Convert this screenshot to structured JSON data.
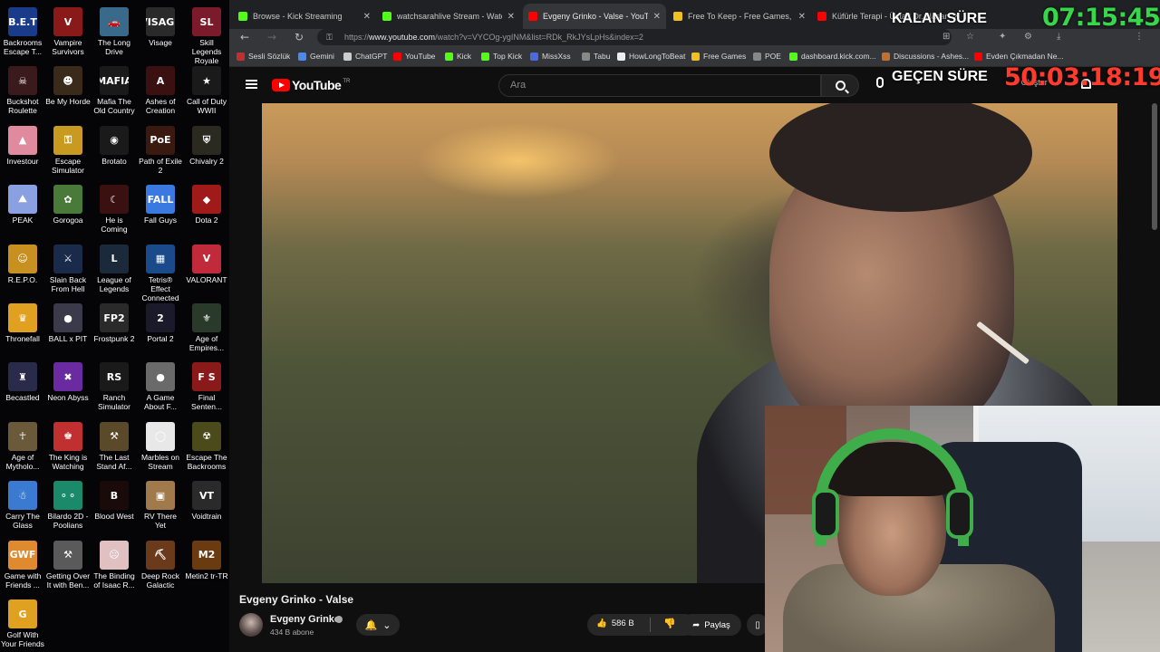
{
  "desktop_icons": [
    {
      "label": "Backrooms Escape T...",
      "glyph": "B.E.T",
      "color": "#1a3a8a"
    },
    {
      "label": "Vampire Survivors",
      "glyph": "V",
      "color": "#8a1a1a"
    },
    {
      "label": "The Long Drive",
      "glyph": "🚗",
      "color": "#3a6a8a"
    },
    {
      "label": "Visage",
      "glyph": "VISAGE",
      "color": "#2a2a2a"
    },
    {
      "label": "Skill Legends Royale",
      "glyph": "SL",
      "color": "#7a1a2a"
    },
    {
      "label": "Buckshot Roulette",
      "glyph": "☠",
      "color": "#3a1a1a"
    },
    {
      "label": "Be My Horde",
      "glyph": "☻",
      "color": "#3a2a1a"
    },
    {
      "label": "Mafia The Old Country",
      "glyph": "MAFIA",
      "color": "#1a1a1a"
    },
    {
      "label": "Ashes of Creation",
      "glyph": "A",
      "color": "#3a1010"
    },
    {
      "label": "Call of Duty WWII",
      "glyph": "★",
      "color": "#1a1a1a"
    },
    {
      "label": "Investour",
      "glyph": "▲",
      "color": "#e08aa0"
    },
    {
      "label": "Escape Simulator",
      "glyph": "⚿",
      "color": "#c89a20"
    },
    {
      "label": "Brotato",
      "glyph": "◉",
      "color": "#1a1a1a"
    },
    {
      "label": "Path of Exile 2",
      "glyph": "PoE",
      "color": "#3a1a10"
    },
    {
      "label": "Chivalry 2",
      "glyph": "⛨",
      "color": "#2a2a20"
    },
    {
      "label": "PEAK",
      "glyph": "⛰",
      "color": "#8aa0e0"
    },
    {
      "label": "Gorogoa",
      "glyph": "✿",
      "color": "#4a7a3a"
    },
    {
      "label": "He is Coming",
      "glyph": "☾",
      "color": "#3a1010"
    },
    {
      "label": "Fall Guys",
      "glyph": "FALL",
      "color": "#3a7ae0"
    },
    {
      "label": "Dota 2",
      "glyph": "◆",
      "color": "#a01a1a"
    },
    {
      "label": "R.E.P.O.",
      "glyph": "☺",
      "color": "#c89020"
    },
    {
      "label": "Slain Back From Hell",
      "glyph": "⚔",
      "color": "#1a2a4a"
    },
    {
      "label": "League of Legends",
      "glyph": "L",
      "color": "#1a2a3a"
    },
    {
      "label": "Tetris® Effect Connected",
      "glyph": "▦",
      "color": "#1a4a8a"
    },
    {
      "label": "VALORANT",
      "glyph": "V",
      "color": "#c02a3a"
    },
    {
      "label": "Thronefall",
      "glyph": "♛",
      "color": "#e0a020"
    },
    {
      "label": "BALL x PIT",
      "glyph": "●",
      "color": "#3a3a4a"
    },
    {
      "label": "Frostpunk 2",
      "glyph": "FP2",
      "color": "#2a2a2a"
    },
    {
      "label": "Portal 2",
      "glyph": "2",
      "color": "#1a1a2a"
    },
    {
      "label": "Age of Empires...",
      "glyph": "⚜",
      "color": "#2a3a2a"
    },
    {
      "label": "Becastled",
      "glyph": "♜",
      "color": "#2a2a4a"
    },
    {
      "label": "Neon Abyss",
      "glyph": "✖",
      "color": "#6a2aa0"
    },
    {
      "label": "Ranch Simulator",
      "glyph": "RS",
      "color": "#1a1a1a"
    },
    {
      "label": "A Game About F...",
      "glyph": "●",
      "color": "#6a6a6a"
    },
    {
      "label": "Final Senten...",
      "glyph": "F S",
      "color": "#8a1a1a"
    },
    {
      "label": "Age of Mytholo...",
      "glyph": "☥",
      "color": "#6a5a3a"
    },
    {
      "label": "The King is Watching",
      "glyph": "♚",
      "color": "#c03030"
    },
    {
      "label": "The Last Stand Af...",
      "glyph": "⚒",
      "color": "#5a4a2a"
    },
    {
      "label": "Marbles on Stream",
      "glyph": "◯",
      "color": "#e8e8e8"
    },
    {
      "label": "Escape The Backrooms",
      "glyph": "☢",
      "color": "#4a4a1a"
    },
    {
      "label": "Carry The Glass",
      "glyph": "☃",
      "color": "#3a7ad0"
    },
    {
      "label": "Bilardo 2D - Poolians",
      "glyph": "⚬⚬",
      "color": "#1a8a6a"
    },
    {
      "label": "Blood West",
      "glyph": "B",
      "color": "#1a0a0a"
    },
    {
      "label": "RV There Yet",
      "glyph": "▣",
      "color": "#a07a4a"
    },
    {
      "label": "Voidtrain",
      "glyph": "VT",
      "color": "#2a2a2a"
    },
    {
      "label": "Game with Friends ...",
      "glyph": "GWF",
      "color": "#e08a30"
    },
    {
      "label": "Getting Over It with Ben...",
      "glyph": "⚒",
      "color": "#5a5a5a"
    },
    {
      "label": "The Binding of Isaac R...",
      "glyph": "☹",
      "color": "#e0c0c0"
    },
    {
      "label": "Deep Rock Galactic",
      "glyph": "⛏",
      "color": "#6a3a1a"
    },
    {
      "label": "Metin2 tr-TR",
      "glyph": "M2",
      "color": "#6a3a10"
    },
    {
      "label": "Golf With Your Friends",
      "glyph": "G",
      "color": "#e0a020"
    }
  ],
  "tabs": [
    {
      "title": "Browse - Kick Streaming",
      "fav_color": "#53fc18",
      "active": false
    },
    {
      "title": "watchsarahlive Stream - Watch Live",
      "fav_color": "#53fc18",
      "active": false
    },
    {
      "title": "Evgeny Grinko - Valse - YouTube",
      "fav_color": "#ff0000",
      "active": true
    },
    {
      "title": "Free To Keep - Free Games, Every",
      "fav_color": "#f0c020",
      "active": false
    },
    {
      "title": "Küfürle Terapi - Üstad Dr. Hasan",
      "fav_color": "#ff0000",
      "active": false
    }
  ],
  "address": {
    "scheme": "https://",
    "host": "www.youtube.com",
    "path": "/watch?v=VYCOg-ygINM&list=RDk_RkJYsLpHs&index=2"
  },
  "bookmarks": [
    {
      "label": "Sesli Sözlük",
      "color": "#c03030"
    },
    {
      "label": "Gemini",
      "color": "#4a8af0"
    },
    {
      "label": "ChatGPT",
      "color": "#cccccc"
    },
    {
      "label": "YouTube",
      "color": "#ff0000"
    },
    {
      "label": "Kick",
      "color": "#53fc18"
    },
    {
      "label": "Top Kick",
      "color": "#53fc18"
    },
    {
      "label": "MissXss",
      "color": "#4a6ae0"
    },
    {
      "label": "Tabu",
      "color": "#888888"
    },
    {
      "label": "HowLongToBeat",
      "color": "#eeeeee"
    },
    {
      "label": "Free Games",
      "color": "#f0c020"
    },
    {
      "label": "POE",
      "color": "#888888"
    },
    {
      "label": "dashboard.kick.com...",
      "color": "#53fc18"
    },
    {
      "label": "Discussions - Ashes...",
      "color": "#c07030"
    },
    {
      "label": "Evden Çıkmadan Ne...",
      "color": "#ff0000"
    }
  ],
  "youtube": {
    "logo_text": "YouTube",
    "country_code": "TR",
    "search_placeholder": "Ara",
    "create_label": "+ Oluştur",
    "video_title": "Evgeny Grinko - Valse",
    "channel_name": "Evgeny Grinko",
    "subscribers": "434 B abone",
    "likes": "586 B",
    "share_label": "Paylaş"
  },
  "overlay": {
    "remaining_label": "KALAN SÜRE",
    "remaining_time": "07:15:45",
    "elapsed_label": "GEÇEN SÜRE",
    "elapsed_time": "50:03:18:19"
  }
}
